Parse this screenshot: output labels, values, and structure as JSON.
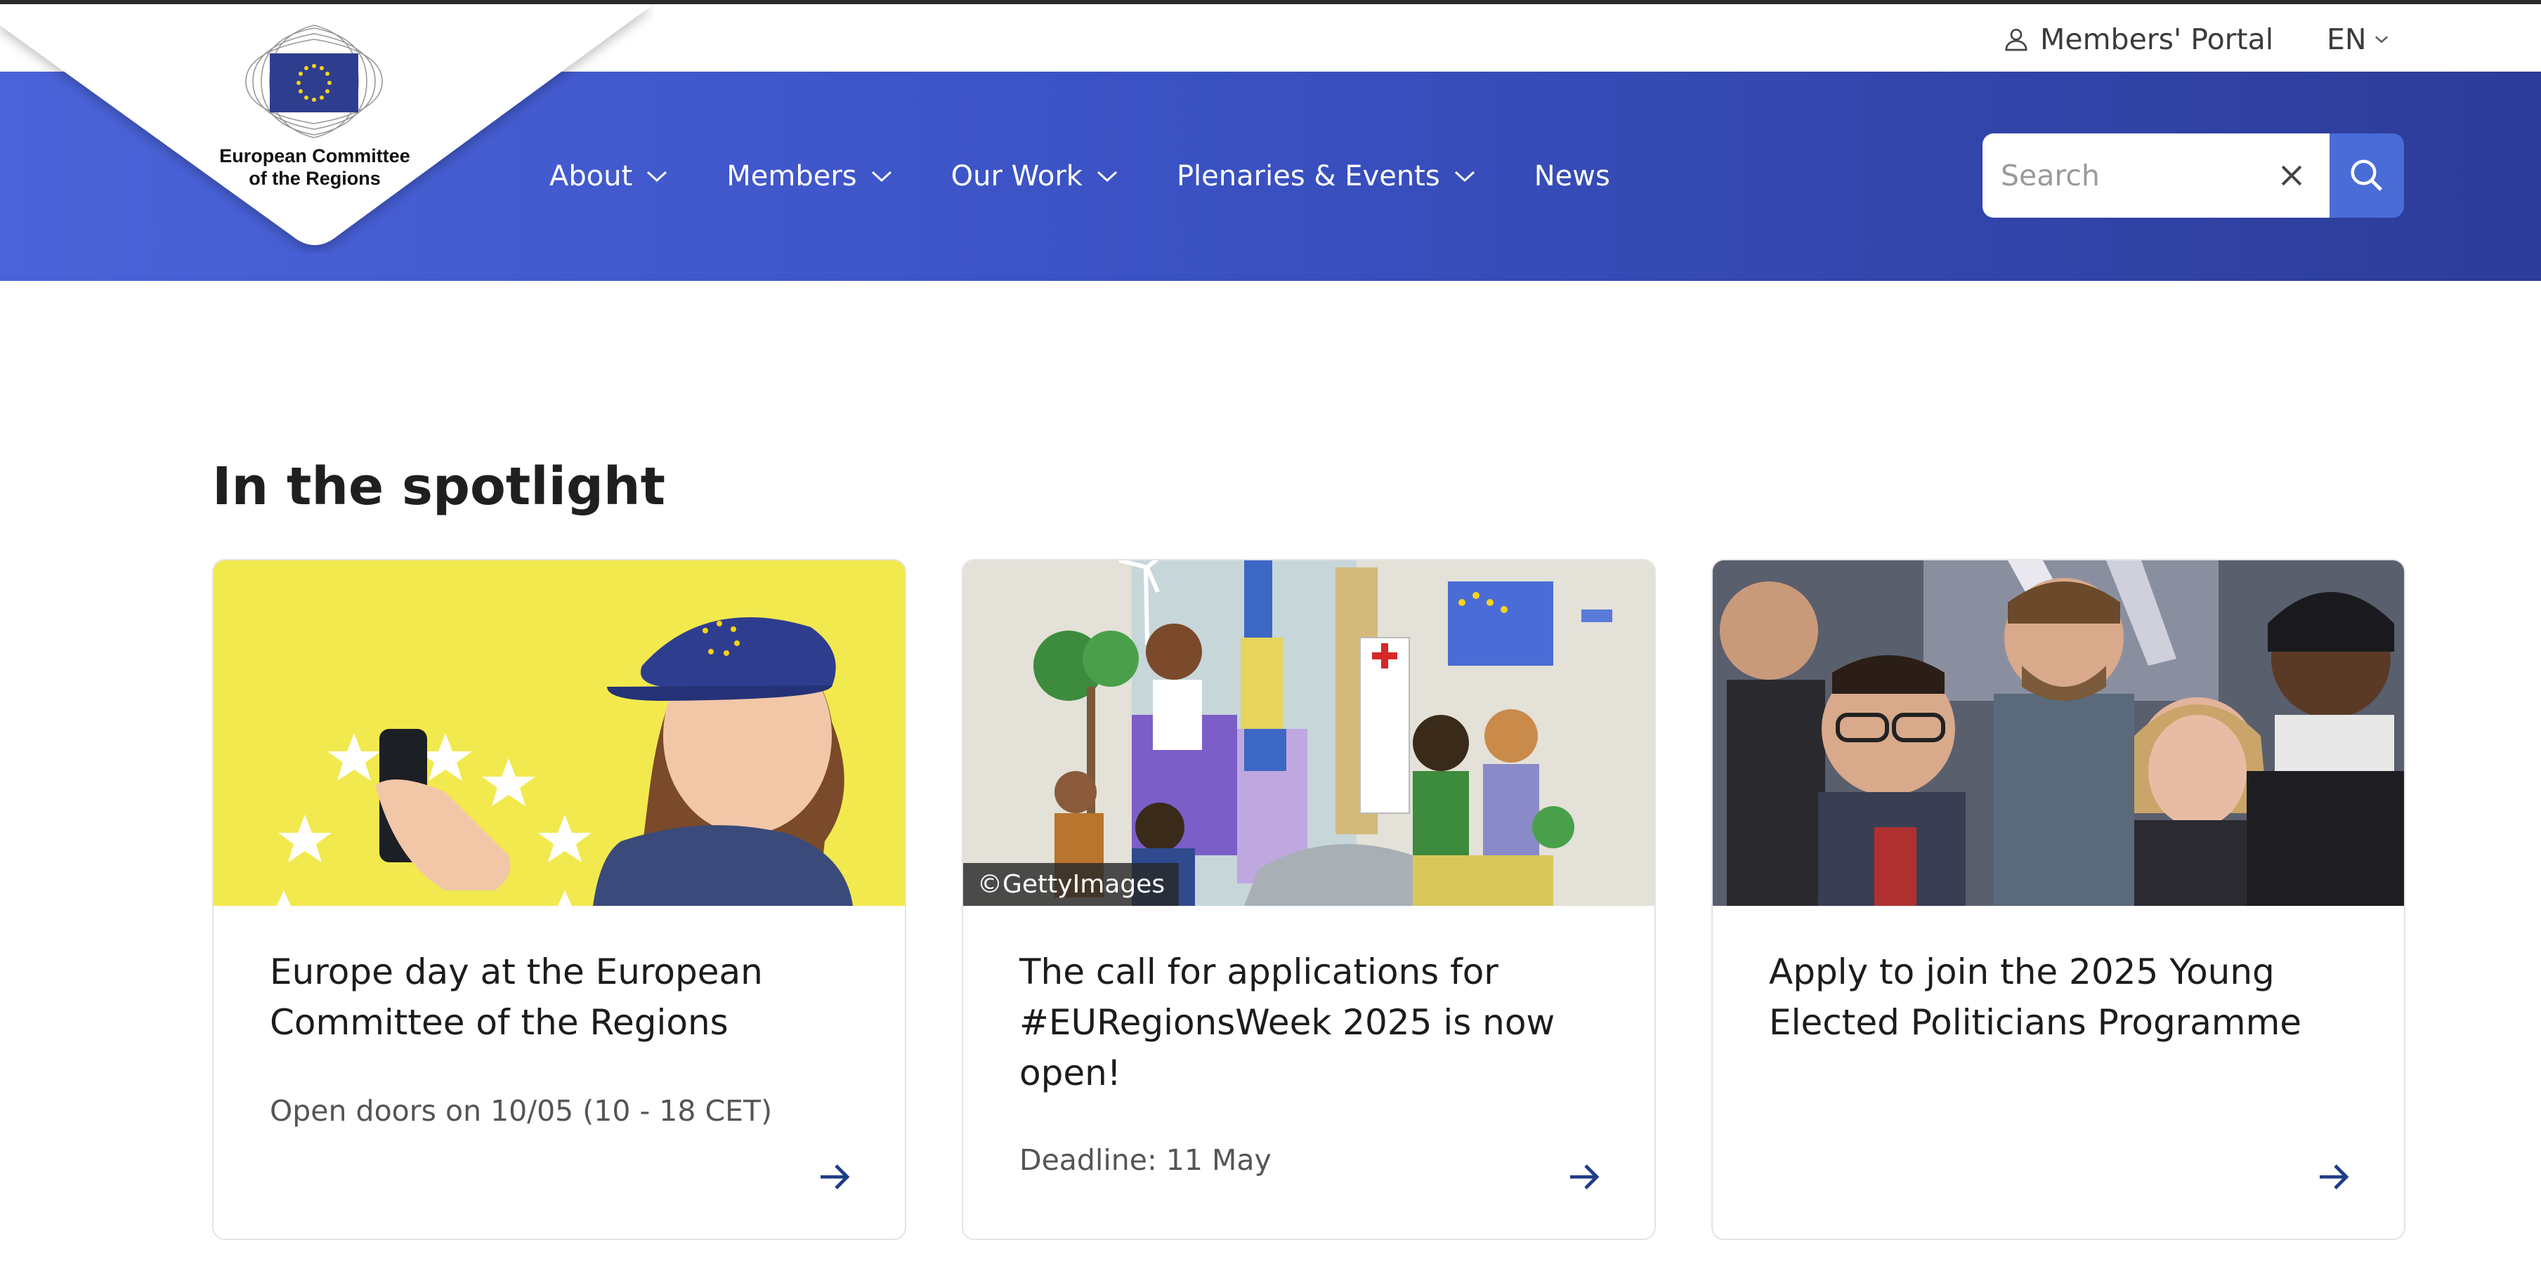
{
  "utility": {
    "members_portal": "Members' Portal",
    "language": "EN"
  },
  "logo": {
    "line1": "European Committee",
    "line2": "of the Regions"
  },
  "nav": {
    "items": [
      {
        "label": "About",
        "has_dropdown": true
      },
      {
        "label": "Members",
        "has_dropdown": true
      },
      {
        "label": "Our Work",
        "has_dropdown": true
      },
      {
        "label": "Plenaries & Events",
        "has_dropdown": true
      },
      {
        "label": "News",
        "has_dropdown": false
      }
    ]
  },
  "search": {
    "placeholder": "Search",
    "value": ""
  },
  "spotlight": {
    "title": "In the spotlight",
    "cards": [
      {
        "title": "Europe day at the European Committee of the Regions",
        "subtitle": "Open doors on 10/05 (10 - 18 CET)",
        "image_credit": ""
      },
      {
        "title": "The call for applications for #EURegionsWeek 2025 is now open!",
        "subtitle": "Deadline: 11 May",
        "image_credit": "©GettyImages"
      },
      {
        "title": "Apply to join the 2025 Young Elected Politicians Programme",
        "subtitle": "",
        "image_credit": ""
      }
    ]
  },
  "colors": {
    "nav_gradient_start": "#4a63d8",
    "nav_gradient_end": "#2c3c98",
    "search_button": "#4a6cd6",
    "arrow": "#1f3c88"
  }
}
